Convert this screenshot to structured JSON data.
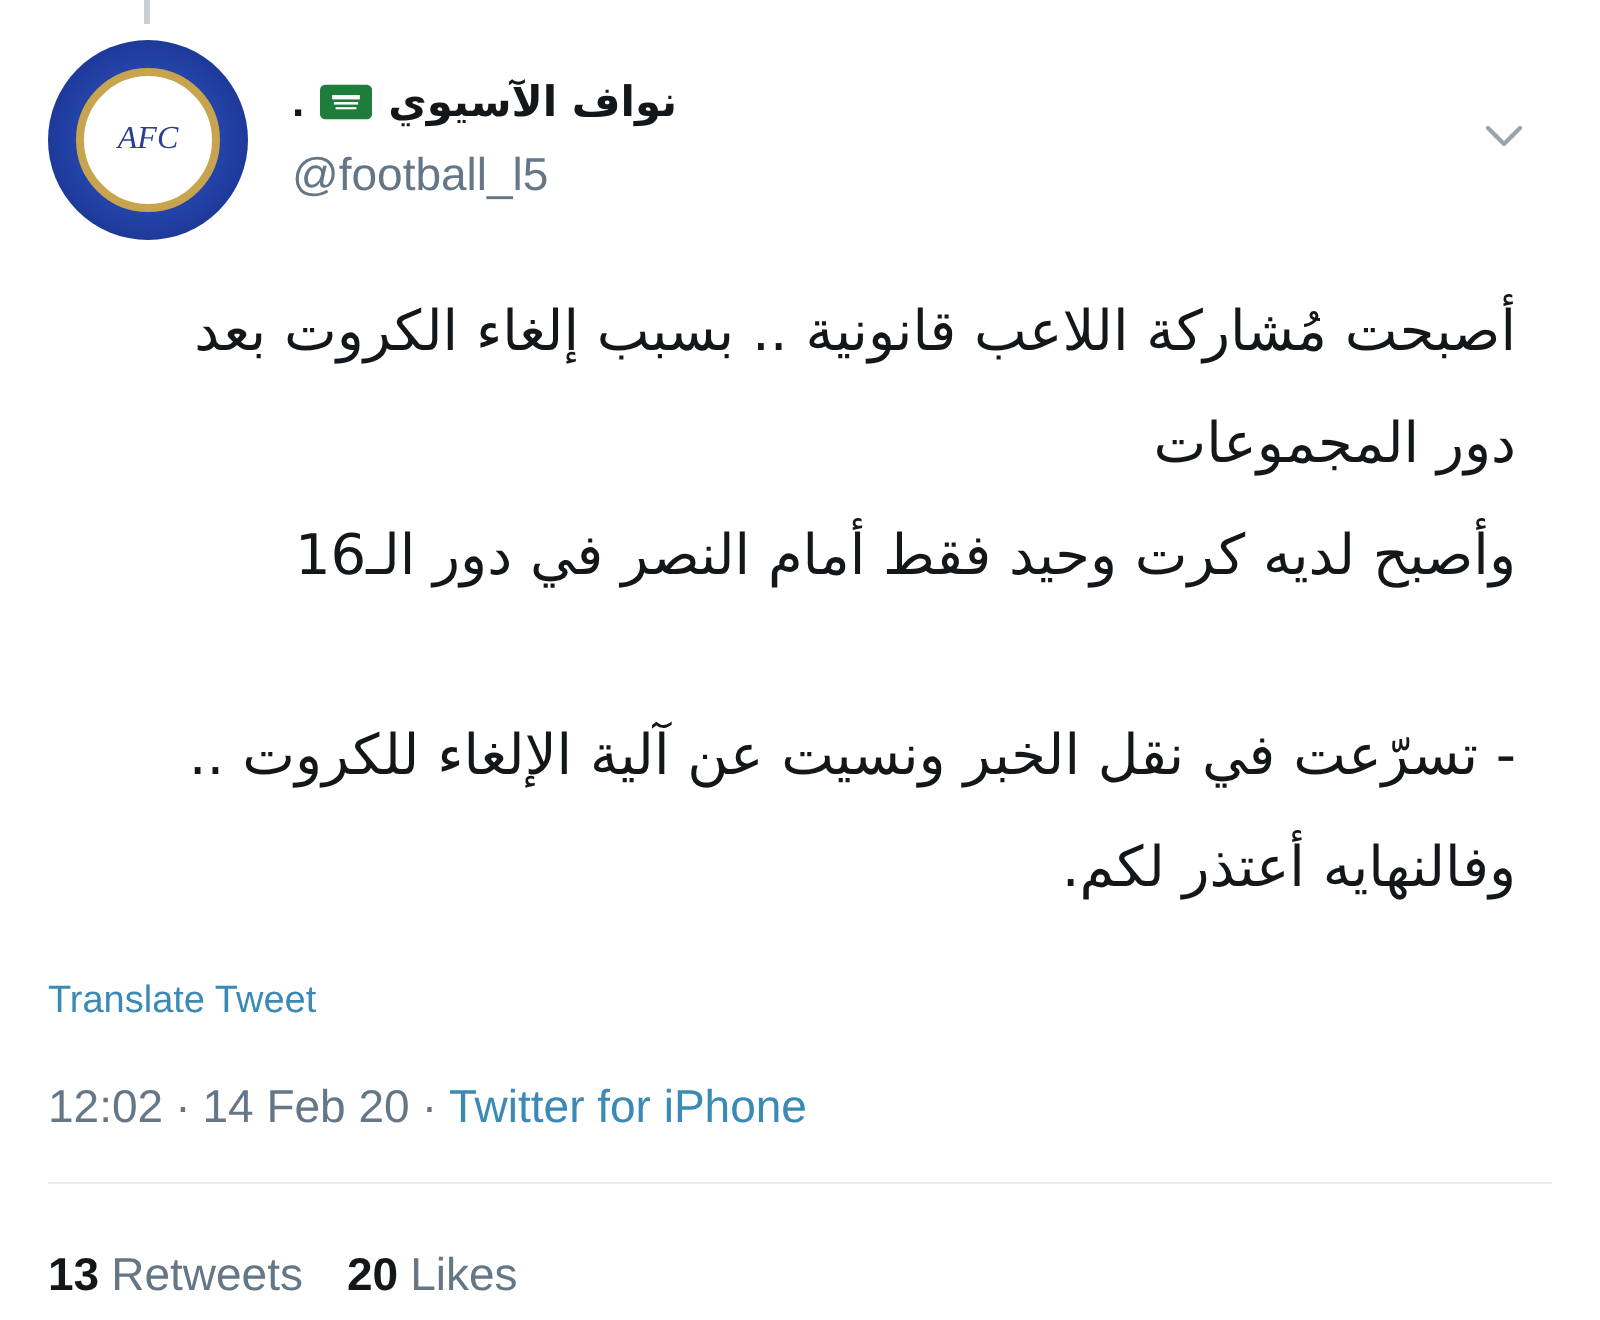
{
  "tweet": {
    "avatar": {
      "label": "AFC"
    },
    "author": {
      "display_name": "نواف الآسيوي",
      "suffix": ".",
      "handle": "@football_l5"
    },
    "body": [
      {
        "lines": [
          "أصبحت مُشاركة اللاعب قانونية .. بسبب إلغاء الكروت بعد",
          "دور المجموعات"
        ]
      },
      {
        "lines": [
          "وأصبح لديه كرت وحيد فقط أمام النصر في دور الـ16"
        ]
      },
      {
        "lines": [
          "- تسرّعت في نقل الخبر ونسيت عن آلية الإلغاء للكروت ..",
          "وفالنهايه أعتذر لكم."
        ]
      }
    ],
    "translate_link": "Translate Tweet",
    "time": "12:02",
    "separator": "·",
    "date": "14 Feb 20",
    "source_separator": "·",
    "source": "Twitter for iPhone",
    "retweets": {
      "count": "13",
      "label": "Retweets"
    },
    "likes": {
      "count": "20",
      "label": "Likes"
    }
  }
}
